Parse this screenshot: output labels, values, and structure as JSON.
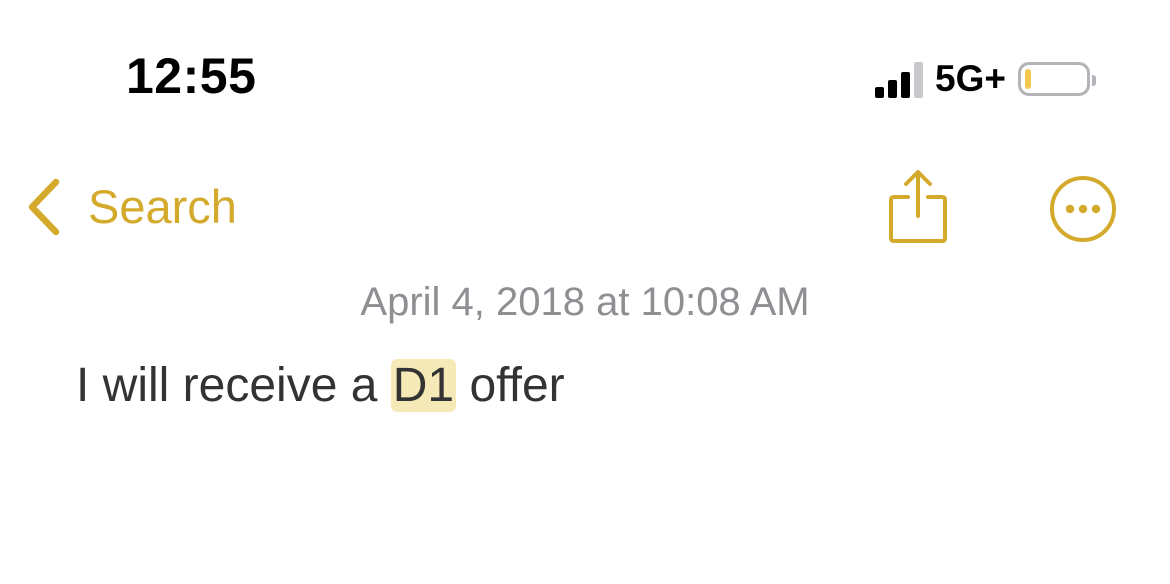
{
  "status_bar": {
    "time": "12:55",
    "network": "5G+",
    "signal_bars_active": 3,
    "signal_bars_total": 4,
    "battery_level": 0.1,
    "battery_color": "#f2c94c"
  },
  "nav": {
    "back_label": "Search",
    "back_icon": "chevron-left-icon",
    "share_icon": "share-icon",
    "more_icon": "ellipsis-circle-icon",
    "accent_color": "#d4aa2d"
  },
  "note": {
    "date": "April 4, 2018 at 10:08 AM",
    "text_before": "I will receive a ",
    "text_highlight": "D1",
    "text_after": " offer"
  }
}
